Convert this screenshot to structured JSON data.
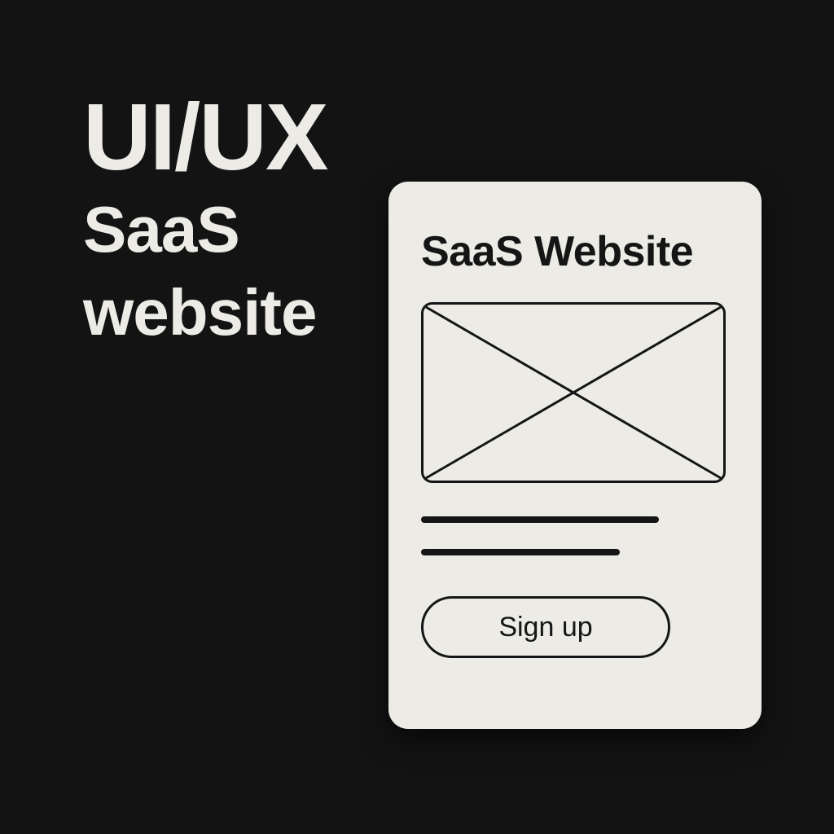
{
  "headline": {
    "primary": "UI/UX",
    "line2": "SaaS",
    "line3": "website"
  },
  "card": {
    "title": "SaaS Website",
    "image_placeholder_icon": "image-placeholder-icon",
    "signup_label": "Sign up"
  },
  "colors": {
    "background": "#131313",
    "headline_text": "#ecebe6",
    "card_background": "#ecebe6",
    "card_ink": "#151515"
  }
}
